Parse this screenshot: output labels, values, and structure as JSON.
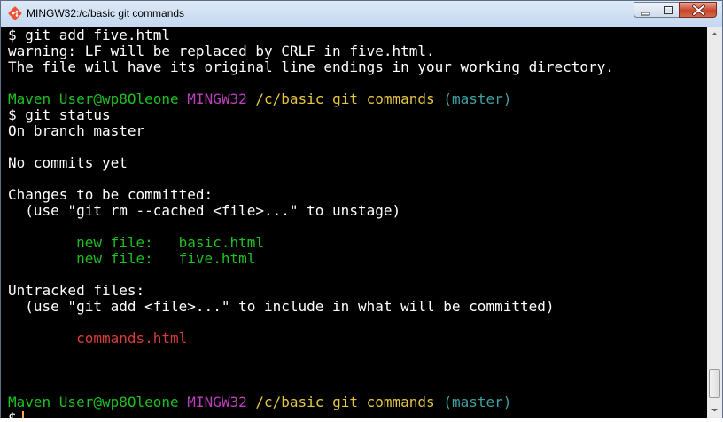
{
  "window": {
    "title": "MINGW32:/c/basic git commands"
  },
  "icons": {
    "app": "git-bash-icon",
    "minimize": "minimize-icon",
    "maximize": "maximize-icon",
    "close": "close-icon",
    "scroll_up": "scroll-up-arrow-icon",
    "scroll_down": "scroll-down-arrow-icon"
  },
  "colors": {
    "background": "#000000",
    "text": "#ffffff",
    "green": "#1dc121",
    "purple": "#bc3fbc",
    "yellow": "#e5c63f",
    "cyan": "#3ea1a1",
    "red": "#d83d3d",
    "cursor": "#ffa84a"
  },
  "console": {
    "lines": [
      [
        {
          "text": "$ git add five.html",
          "color": "white"
        }
      ],
      [
        {
          "text": "warning: LF will be replaced by CRLF in five.html.",
          "color": "white"
        }
      ],
      [
        {
          "text": "The file will have its original line endings in your working directory.",
          "color": "white"
        }
      ],
      [
        {
          "text": "",
          "color": "white"
        }
      ],
      [
        {
          "text": "Maven User@wp8Oleone",
          "color": "green"
        },
        {
          "text": " ",
          "color": "white"
        },
        {
          "text": "MINGW32",
          "color": "purple"
        },
        {
          "text": " ",
          "color": "white"
        },
        {
          "text": "/c/basic git commands",
          "color": "yellow"
        },
        {
          "text": " ",
          "color": "white"
        },
        {
          "text": "(master)",
          "color": "cyan"
        }
      ],
      [
        {
          "text": "$ git status",
          "color": "white"
        }
      ],
      [
        {
          "text": "On branch master",
          "color": "white"
        }
      ],
      [
        {
          "text": "",
          "color": "white"
        }
      ],
      [
        {
          "text": "No commits yet",
          "color": "white"
        }
      ],
      [
        {
          "text": "",
          "color": "white"
        }
      ],
      [
        {
          "text": "Changes to be committed:",
          "color": "white"
        }
      ],
      [
        {
          "text": "  (use \"git rm --cached <file>...\" to unstage)",
          "color": "white"
        }
      ],
      [
        {
          "text": "",
          "color": "white"
        }
      ],
      [
        {
          "text": "        new file:   basic.html",
          "color": "green"
        }
      ],
      [
        {
          "text": "        new file:   five.html",
          "color": "green"
        }
      ],
      [
        {
          "text": "",
          "color": "white"
        }
      ],
      [
        {
          "text": "Untracked files:",
          "color": "white"
        }
      ],
      [
        {
          "text": "  (use \"git add <file>...\" to include in what will be committed)",
          "color": "white"
        }
      ],
      [
        {
          "text": "",
          "color": "white"
        }
      ],
      [
        {
          "text": "        commands.html",
          "color": "red"
        }
      ],
      [
        {
          "text": "",
          "color": "white"
        }
      ],
      [
        {
          "text": "",
          "color": "white"
        }
      ],
      [
        {
          "text": "",
          "color": "white"
        }
      ],
      [
        {
          "text": "Maven User@wp8Oleone",
          "color": "green"
        },
        {
          "text": " ",
          "color": "white"
        },
        {
          "text": "MINGW32",
          "color": "purple"
        },
        {
          "text": " ",
          "color": "white"
        },
        {
          "text": "/c/basic git commands",
          "color": "yellow"
        },
        {
          "text": " ",
          "color": "white"
        },
        {
          "text": "(master)",
          "color": "cyan"
        }
      ]
    ],
    "prompt": "$"
  }
}
